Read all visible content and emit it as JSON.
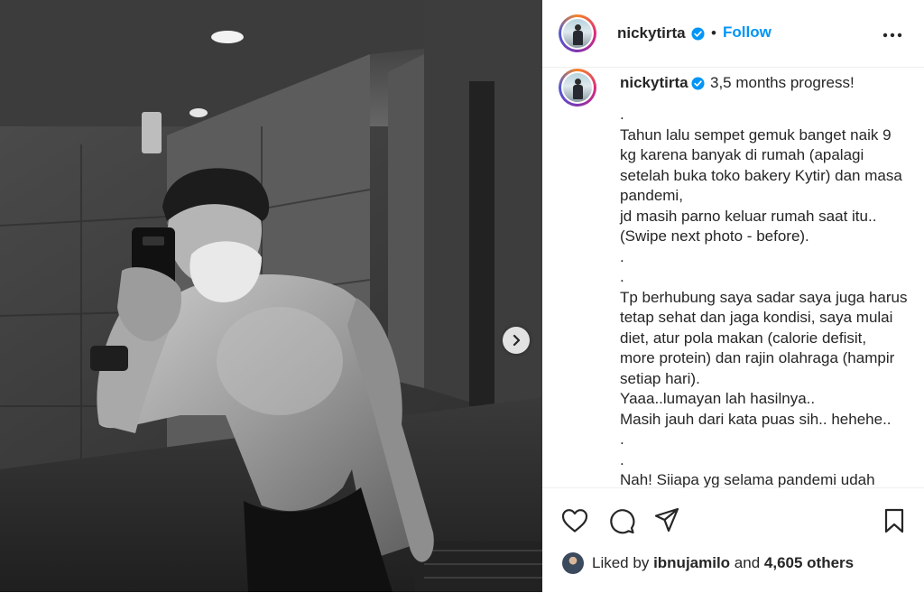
{
  "post": {
    "username": "nickytirta",
    "follow_label": "Follow",
    "separator": "•",
    "caption_first_line": "3,5 months progress!",
    "caption_lines": [
      ".",
      "Tahun lalu sempet gemuk banget naik 9",
      "kg karena banyak di rumah (apalagi",
      "setelah buka toko bakery Kytir) dan masa",
      "pandemi,",
      "jd masih parno keluar rumah saat itu..",
      "(Swipe next photo - before).",
      ".",
      ".",
      "Tp berhubung saya sadar saya juga harus",
      "tetap sehat dan jaga kondisi, saya mulai",
      "diet, atur pola makan (calorie defisit,",
      "more protein) dan rajin olahraga (hampir",
      "setiap hari).",
      "Yaaa..lumayan lah hasilnya..",
      "Masih jauh dari kata puas sih.. hehehe..",
      ".",
      ".",
      "Nah! Siiapa yg selama pandemi udah"
    ],
    "likes": {
      "prefix": "Liked by",
      "liker": "ibnujamilo",
      "joiner": "and",
      "others": "4,605 others"
    }
  },
  "icons": {
    "verified": "verified-badge-icon",
    "more": "more-options-icon",
    "next": "chevron-right-icon",
    "like": "heart-icon",
    "comment": "comment-icon",
    "share": "paper-plane-icon",
    "save": "bookmark-icon"
  },
  "colors": {
    "accent": "#0095f6",
    "text": "#262626",
    "divider": "#efefef"
  }
}
